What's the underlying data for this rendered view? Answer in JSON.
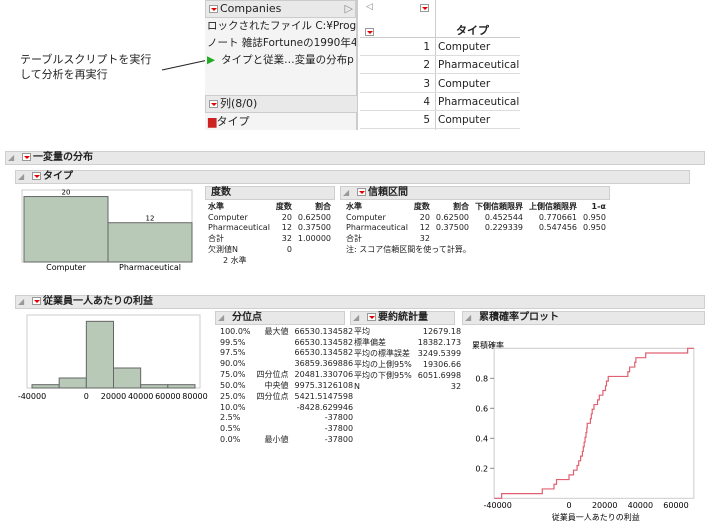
{
  "callout": {
    "line1": "テーブルスクリプトを実行",
    "line2": "して分析を再実行"
  },
  "table_panel": {
    "title": "Companies",
    "items": [
      "ロックされたファイル C:¥Progr",
      "ノート 雑誌Fortuneの1990年4",
      "タイプと従業…変量の分布p"
    ],
    "columns_header": "列(8/0)",
    "column_item": "タイプ"
  },
  "grid": {
    "column": "タイプ",
    "rows": [
      {
        "n": "1",
        "v": "Computer"
      },
      {
        "n": "2",
        "v": "Pharmaceutical"
      },
      {
        "n": "3",
        "v": "Computer"
      },
      {
        "n": "4",
        "v": "Pharmaceutical"
      },
      {
        "n": "5",
        "v": "Computer"
      }
    ]
  },
  "report": {
    "title": "一変量の分布",
    "type_section": {
      "title": "タイプ",
      "freq": {
        "title": "度数",
        "headers": [
          "水準",
          "度数",
          "割合"
        ],
        "rows": [
          [
            "Computer",
            "20",
            "0.62500"
          ],
          [
            "Pharmaceutical",
            "12",
            "0.37500"
          ],
          [
            "合計",
            "32",
            "1.00000"
          ]
        ],
        "missing_label": "欠測値N",
        "missing": "0",
        "levels": "2 水準"
      },
      "ci": {
        "title": "信頼区間",
        "headers": [
          "水準",
          "度数",
          "割合",
          "下側信頼限界",
          "上側信頼限界",
          "1-α"
        ],
        "rows": [
          [
            "Computer",
            "20",
            "0.62500",
            "0.452544",
            "0.770661",
            "0.950"
          ],
          [
            "Pharmaceutical",
            "12",
            "0.37500",
            "0.229339",
            "0.547456",
            "0.950"
          ],
          [
            "合計",
            "32",
            "",
            "",
            "",
            ""
          ]
        ],
        "note": "注: スコア信頼区間を使って計算。"
      }
    },
    "profit_section": {
      "title": "従業員一人あたりの利益",
      "quantiles": {
        "title": "分位点",
        "rows": [
          [
            "100.0%",
            "最大値",
            "66530.134582"
          ],
          [
            "99.5%",
            "",
            "66530.134582"
          ],
          [
            "97.5%",
            "",
            "66530.134582"
          ],
          [
            "90.0%",
            "",
            "36859.369886"
          ],
          [
            "75.0%",
            "四分位点",
            "20481.330706"
          ],
          [
            "50.0%",
            "中央値",
            "9975.3126108"
          ],
          [
            "25.0%",
            "四分位点",
            "5421.5147598"
          ],
          [
            "10.0%",
            "",
            "-8428.629946"
          ],
          [
            "2.5%",
            "",
            "-37800"
          ],
          [
            "0.5%",
            "",
            "-37800"
          ],
          [
            "0.0%",
            "最小値",
            "-37800"
          ]
        ]
      },
      "summary": {
        "title": "要約統計量",
        "rows": [
          [
            "平均",
            "12679.18"
          ],
          [
            "標準偏差",
            "18382.173"
          ],
          [
            "平均の標準誤差",
            "3249.5399"
          ],
          [
            "平均の上側95%",
            "19306.66"
          ],
          [
            "平均の下側95%",
            "6051.6998"
          ],
          [
            "N",
            "32"
          ]
        ]
      },
      "cdf_title": "累積確率プロット"
    }
  },
  "chart_data": [
    {
      "type": "bar",
      "categories": [
        "Computer",
        "Pharmaceutical"
      ],
      "values": [
        20,
        12
      ],
      "ylim": [
        0,
        20
      ]
    },
    {
      "type": "bar",
      "title": "従業員一人あたりの利益 histogram",
      "bin_edges": [
        -40000,
        -20000,
        0,
        20000,
        40000,
        60000,
        80000
      ],
      "values": [
        1,
        3,
        20,
        6,
        1,
        1
      ],
      "xticks": [
        "-40000",
        "0",
        "20000",
        "40000",
        "60000",
        "80000"
      ]
    },
    {
      "type": "line",
      "title": "累積確率プロット",
      "ylabel": "累積確率",
      "xlabel": "従業員一人あたりの利益",
      "xlim": [
        -42000,
        70000
      ],
      "ylim": [
        0,
        1
      ],
      "xticks": [
        "-40000",
        "0",
        "20000",
        "40000",
        "60000"
      ],
      "yticks": [
        "0.2",
        "0.4",
        "0.6",
        "0.8"
      ],
      "x": [
        -37800,
        -15000,
        -8429,
        -7000,
        0,
        2500,
        4500,
        5422,
        6500,
        7500,
        8000,
        8500,
        9000,
        9500,
        9975,
        10200,
        12000,
        12500,
        13000,
        14000,
        16000,
        17000,
        19000,
        20481,
        21000,
        22000,
        33000,
        34000,
        36859,
        37500,
        43000,
        66530
      ]
    }
  ]
}
